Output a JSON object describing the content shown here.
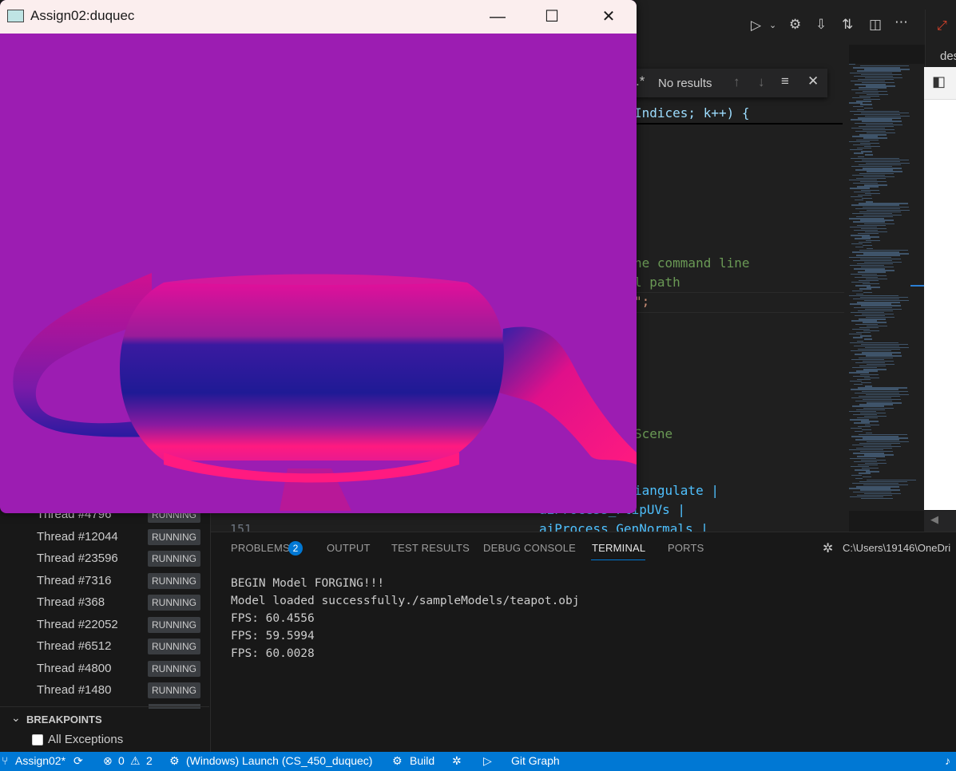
{
  "vscode": {
    "editor_fragments": [
      {
        "text": "Indices; k++) {",
        "color": "#9cdcfe"
      },
      {
        "text": "ne command line",
        "color": "#6a9955"
      },
      {
        "text": "l path",
        "color": "#6a9955"
      },
      {
        "text": "\";",
        "color": "#ce9178"
      },
      {
        "text": "Scene",
        "color": "#6a9955"
      },
      {
        "text": "iangulate |",
        "color": "#4fc1ff"
      },
      {
        "text": "aiProcess_FlipUVs |",
        "color": "#4fc1ff"
      },
      {
        "text": "aiProcess_GenNormals |",
        "color": "#4fc1ff"
      }
    ],
    "line_number": "151",
    "find_widget": {
      "regex_icon_label": ".*",
      "result_text": "No results"
    },
    "right_tab_text": "des",
    "threads": [
      {
        "name": "Thread #4796",
        "status": "RUNNING"
      },
      {
        "name": "Thread #12044",
        "status": "RUNNING"
      },
      {
        "name": "Thread #23596",
        "status": "RUNNING"
      },
      {
        "name": "Thread #7316",
        "status": "RUNNING"
      },
      {
        "name": "Thread #368",
        "status": "RUNNING"
      },
      {
        "name": "Thread #22052",
        "status": "RUNNING"
      },
      {
        "name": "Thread #6512",
        "status": "RUNNING"
      },
      {
        "name": "Thread #4800",
        "status": "RUNNING"
      },
      {
        "name": "Thread #1480",
        "status": "RUNNING"
      }
    ],
    "breakpoints": {
      "title": "BREAKPOINTS",
      "items": [
        {
          "label": "All Exceptions",
          "checked": false
        }
      ]
    },
    "panel": {
      "tabs": [
        "PROBLEMS",
        "OUTPUT",
        "TEST RESULTS",
        "DEBUG CONSOLE",
        "TERMINAL",
        "PORTS"
      ],
      "active_tab": "TERMINAL",
      "problems_count": "2",
      "terminal_path": "C:\\Users\\19146\\OneDri",
      "terminal_lines": [
        "BEGIN Model FORGING!!!",
        "Model loaded successfully./sampleModels/teapot.obj",
        "FPS: 60.4556",
        "FPS: 59.5994",
        "FPS: 60.0028"
      ]
    },
    "statusbar": {
      "branch": "Assign02*",
      "errors": "0",
      "warnings": "2",
      "launch": "(Windows) Launch (CS_450_duquec)",
      "build": "Build",
      "git_graph": "Git Graph"
    }
  },
  "app_window": {
    "title": "Assign02:duquec",
    "background_color": "#9c1db2"
  }
}
